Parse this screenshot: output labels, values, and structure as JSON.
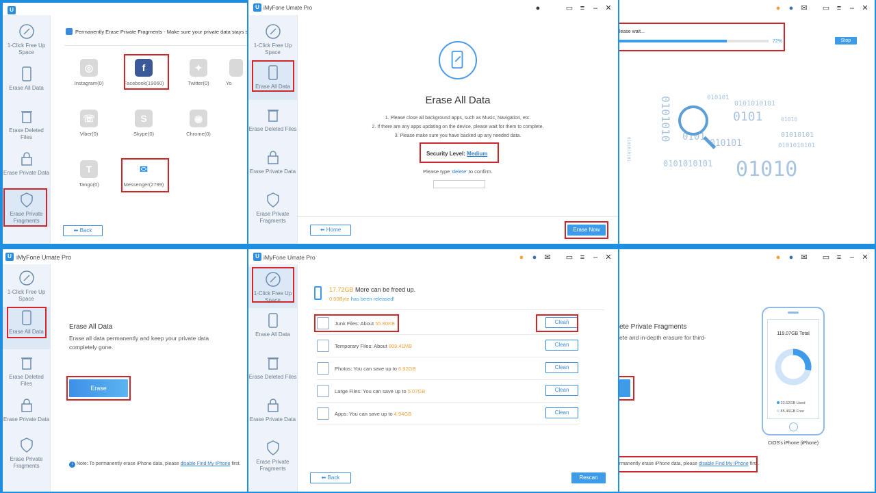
{
  "app": {
    "title": "iMyFone Umate Pro",
    "logo": "U"
  },
  "sidebar": {
    "free_up_space": "1-Click Free Up Space",
    "erase_all": "Erase All Data",
    "erase_deleted": "Erase Deleted Files",
    "erase_private": "Erase Private Data",
    "erase_fragments": "Erase Private Fragments"
  },
  "p1": {
    "header": "Permanently Erase Private Fragments - Make sure your private data stays safe and",
    "apps": [
      {
        "name": "Instagram(0)",
        "icon": "instagram-icon"
      },
      {
        "name": "Facebook(19060)",
        "icon": "facebook-icon"
      },
      {
        "name": "Twitter(0)",
        "icon": "twitter-icon"
      },
      {
        "name": "Yo",
        "icon": "youtube-icon"
      },
      {
        "name": "Viber(0)",
        "icon": "viber-icon"
      },
      {
        "name": "Skype(0)",
        "icon": "skype-icon"
      },
      {
        "name": "Chrome(0)",
        "icon": "chrome-icon"
      },
      {
        "name": "Tango(0)",
        "icon": "tango-icon"
      },
      {
        "name": "Messenger(2799)",
        "icon": "messenger-icon"
      }
    ],
    "back": "Back"
  },
  "p2": {
    "heading": "Erase All Data",
    "steps": [
      "1. Please close all background apps, such as Music, Navigation, etc.",
      "2. If there are any apps updating on the device, please wait for them to complete.",
      "3. Please make sure you have backed up any needed data."
    ],
    "security_label": "Security Level:",
    "security_value": "Medium",
    "confirm_pre": "Please type",
    "confirm_word": "'delete'",
    "confirm_post": "to confirm.",
    "home": "Home",
    "erase_now": "Erase Now"
  },
  "p3": {
    "wait": "lease wait...",
    "percent": "72%",
    "progress": 0.72,
    "stop": "Stop",
    "binary": [
      "0101010",
      "0101",
      "010101",
      "0101010101",
      "01010",
      "0101",
      "01010101",
      "010101",
      "0101010101",
      "0101010101",
      "01010",
      "0101010101"
    ]
  },
  "p4": {
    "heading": "Erase All Data",
    "desc": "Erase all data permanently and keep your private data completely gone.",
    "erase": "Erase",
    "note_pre": "Note: To permanently erase iPhone data, please",
    "note_link": "disable Find My iPhone",
    "note_post": "first."
  },
  "p5": {
    "freed_size": "17.72GB",
    "freed_text": "More can be freed up.",
    "released_size": "0.00Byte",
    "released_text": "has been released!",
    "rows": [
      {
        "label": "Junk Files:",
        "pre": "About",
        "value": "55.80KB",
        "btn": "Clean",
        "icon": "trash-icon"
      },
      {
        "label": "Temporary Files:",
        "pre": "About",
        "value": "809.41MB",
        "btn": "Clean",
        "icon": "temp-file-icon"
      },
      {
        "label": "Photos:",
        "pre": "You can save up to",
        "value": "6.92GB",
        "btn": "Clean",
        "icon": "photo-icon"
      },
      {
        "label": "Large Files:",
        "pre": "You can save up to",
        "value": "5.07GB",
        "btn": "Clean",
        "icon": "folder-icon"
      },
      {
        "label": "Apps:",
        "pre": "You can save up to",
        "value": "4.94GB",
        "btn": "Clean",
        "icon": "apps-icon"
      }
    ],
    "back": "Back",
    "rescan": "Rescan"
  },
  "p6": {
    "heading": "ete Private Fragments",
    "desc": "ete and in-depth erasure for third-",
    "total": "119.07GB Total",
    "used": "33.62GB Used",
    "free": "85.46GB Free",
    "used_fraction": 0.28,
    "device": "CtOS's iPhone (iPhone)",
    "note_pre": "rmanently erase iPhone data, please",
    "note_link": "disable Find My iPhone",
    "note_post": "first."
  },
  "colors": {
    "accent": "#3d9be9",
    "highlight": "#d0242b",
    "orange": "#f0a23a",
    "frame": "#1e8fe0"
  }
}
